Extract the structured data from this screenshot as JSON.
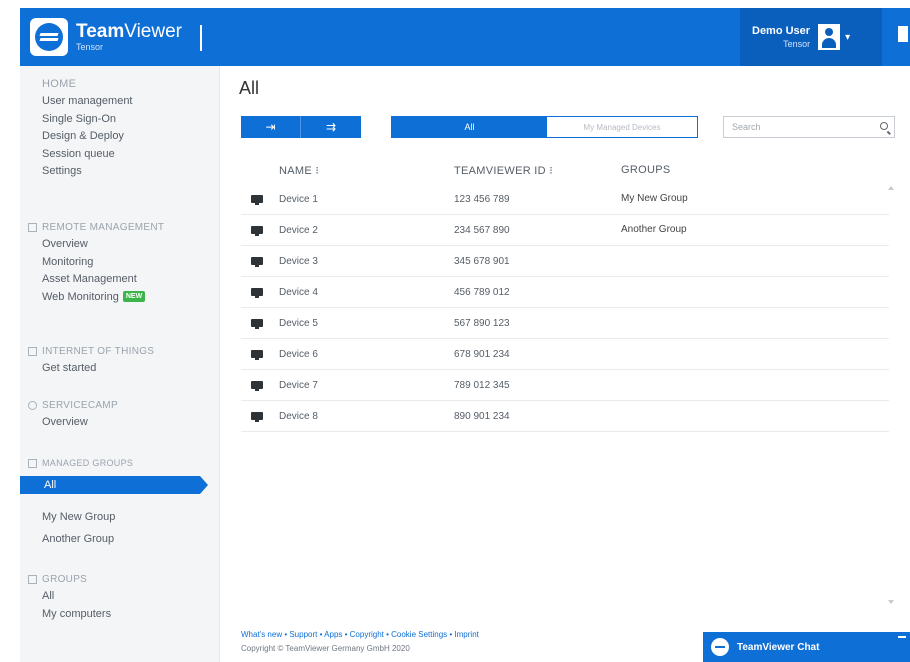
{
  "header": {
    "brand_bold": "Team",
    "brand_rest": "Viewer",
    "brand_sub": "Tensor",
    "user_name": "Demo User",
    "user_sub": "Tensor"
  },
  "sidebar": {
    "home_title": "HOME",
    "home_items": [
      "User management",
      "Single Sign-On",
      "Design & Deploy",
      "Session queue",
      "Settings"
    ],
    "remote_title": "REMOTE MANAGEMENT",
    "remote_items": [
      "Overview",
      "Monitoring",
      "Asset Management",
      "Web Monitoring"
    ],
    "new_badge": "NEW",
    "iot_title": "INTERNET OF THINGS",
    "iot_items": [
      "Get started"
    ],
    "servicecamp_title": "SERVICECAMP",
    "servicecamp_items": [
      "Overview"
    ],
    "managed_title": "MANAGED GROUPS",
    "managed_active": "All",
    "managed_items": [
      "My New Group",
      "Another Group"
    ],
    "groups_title": "GROUPS",
    "groups_items": [
      "All",
      "My computers"
    ]
  },
  "main": {
    "title": "All",
    "btn_add_icon": "⇥",
    "btn_share_icon": "⇉",
    "seg_all": "All",
    "seg_other": "My Managed Devices",
    "search_placeholder": "Search",
    "col_name": "NAME ⁝",
    "col_id": "TEAMVIEWER ID ⁝",
    "col_groups": "GROUPS",
    "rows": [
      {
        "name": "Device 1",
        "id": "123 456 789",
        "group": "My New Group"
      },
      {
        "name": "Device 2",
        "id": "234 567 890",
        "group": "Another Group"
      },
      {
        "name": "Device 3",
        "id": "345 678 901",
        "group": ""
      },
      {
        "name": "Device 4",
        "id": "456 789 012",
        "group": ""
      },
      {
        "name": "Device 5",
        "id": "567 890 123",
        "group": ""
      },
      {
        "name": "Device 6",
        "id": "678 901 234",
        "group": ""
      },
      {
        "name": "Device 7",
        "id": "789 012 345",
        "group": ""
      },
      {
        "name": "Device 8",
        "id": "890 901 234",
        "group": ""
      }
    ]
  },
  "footer": {
    "links": "What's new • Support • Apps • Copyright • Cookie Settings • Imprint",
    "copyright": "Copyright © TeamViewer Germany GmbH 2020"
  },
  "chat": {
    "label": "TeamViewer Chat"
  }
}
